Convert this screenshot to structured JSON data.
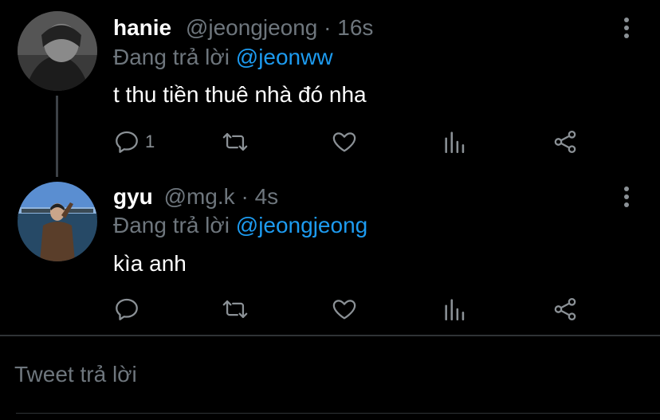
{
  "tweets": [
    {
      "name": "hanie",
      "handle": "@jeongjeong",
      "separator": "·",
      "time": "16s",
      "reply_prefix": "Đang trả lời",
      "reply_to": "@jeonww",
      "text": "t thu tiền thuê nhà đó nha",
      "reply_count": "1"
    },
    {
      "name": "gyu",
      "handle": "@mg.k",
      "separator": "·",
      "time": "4s",
      "reply_prefix": "Đang trả lời",
      "reply_to": "@jeongjeong",
      "text": "kìa anh",
      "reply_count": ""
    }
  ],
  "icons": [
    "reply-icon",
    "retweet-icon",
    "like-icon",
    "analytics-icon",
    "share-icon",
    "more-icon"
  ],
  "colors": {
    "background": "#000000",
    "muted": "#6e767d",
    "mention": "#1d9bf0",
    "icon": "#8b9196"
  },
  "composer": {
    "placeholder": "Tweet trả lời"
  }
}
